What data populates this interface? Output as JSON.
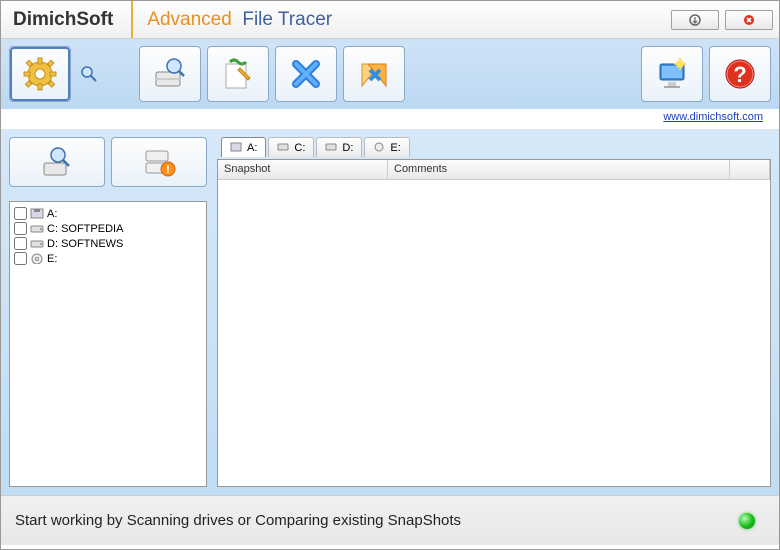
{
  "header": {
    "brand": "DimichSoft",
    "subtitle_adv": "Advanced",
    "subtitle_rest": "File Tracer"
  },
  "link": {
    "url_text": "www.dimichsoft.com"
  },
  "drives": [
    {
      "letter": "A:",
      "label": ""
    },
    {
      "letter": "C:",
      "label": "SOFTPEDIA"
    },
    {
      "letter": "D:",
      "label": "SOFTNEWS"
    },
    {
      "letter": "E:",
      "label": ""
    }
  ],
  "tabs": [
    {
      "label": "A:"
    },
    {
      "label": "C:"
    },
    {
      "label": "D:"
    },
    {
      "label": "E:"
    }
  ],
  "columns": {
    "snapshot": "Snapshot",
    "comments": "Comments"
  },
  "status": "Start working by Scanning  drives or Comparing existing SnapShots"
}
